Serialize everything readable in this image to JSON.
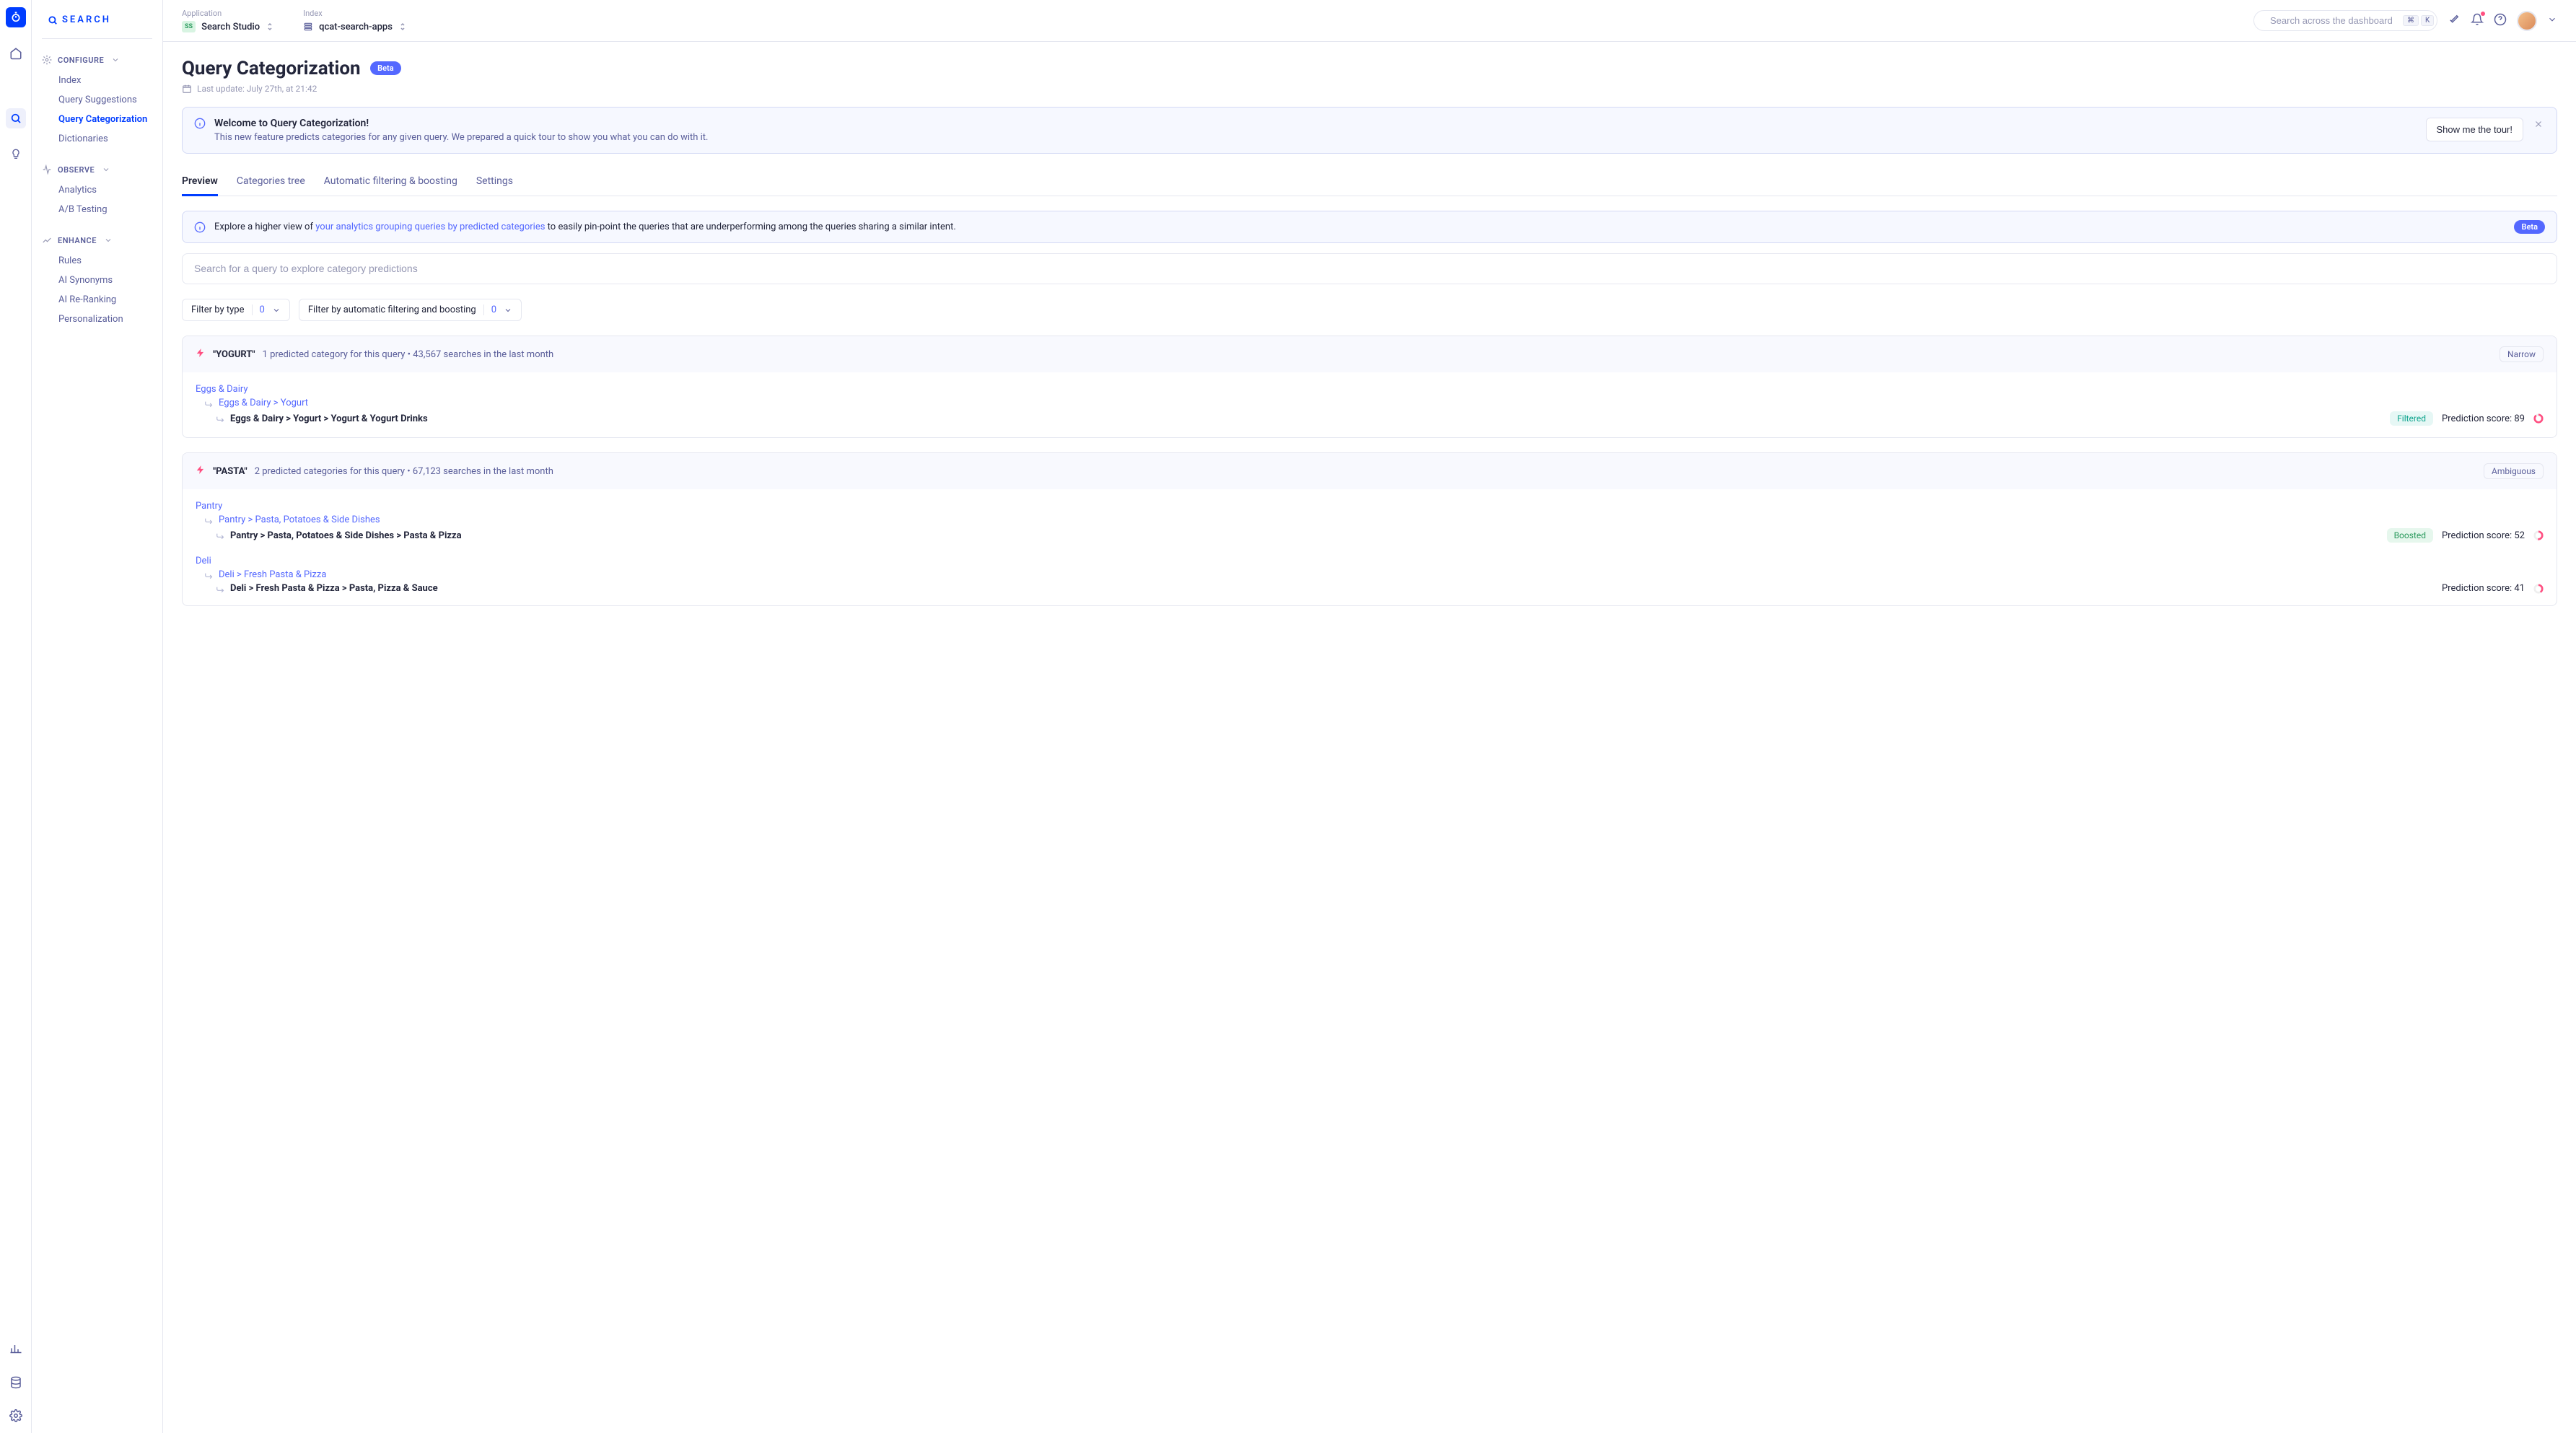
{
  "brand": "SEARCH",
  "topbar": {
    "application_label": "Application",
    "application_value": "Search Studio",
    "application_chip": "SS",
    "index_label": "Index",
    "index_value": "qcat-search-apps",
    "search_placeholder": "Search across the dashboard",
    "kbd1": "⌘",
    "kbd2": "K"
  },
  "sidebar": {
    "sections": [
      {
        "title": "CONFIGURE",
        "items": [
          "Index",
          "Query Suggestions",
          "Query Categorization",
          "Dictionaries"
        ],
        "active": 2
      },
      {
        "title": "OBSERVE",
        "items": [
          "Analytics",
          "A/B Testing"
        ]
      },
      {
        "title": "ENHANCE",
        "items": [
          "Rules",
          "AI Synonyms",
          "AI Re-Ranking",
          "Personalization"
        ]
      }
    ]
  },
  "page": {
    "title": "Query Categorization",
    "beta": "Beta",
    "last_update": "Last update: July 27th, at 21:42"
  },
  "welcome": {
    "title": "Welcome to Query Categorization!",
    "desc": "This new feature predicts categories for any given query. We prepared a quick tour to show you what you can do with it.",
    "button": "Show me the tour!"
  },
  "tabs": [
    "Preview",
    "Categories tree",
    "Automatic filtering & boosting",
    "Settings"
  ],
  "banner": {
    "pre": "Explore a higher view of ",
    "link": "your analytics grouping queries by predicted categories",
    "post": " to easily pin-point the queries that are underperforming among the queries sharing a similar intent.",
    "beta": "Beta"
  },
  "query_search_placeholder": "Search for a query to explore category predictions",
  "filters": {
    "type_label": "Filter by type",
    "type_count": "0",
    "auto_label": "Filter by automatic filtering and boosting",
    "auto_count": "0"
  },
  "results": [
    {
      "query": "\"YOGURT\"",
      "meta": "1 predicted category for this query • 43,567 searches in the last month",
      "tag": "Narrow",
      "blocks": [
        {
          "l0": "Eggs & Dairy",
          "l1": "Eggs & Dairy > Yogurt",
          "l2": "Eggs & Dairy > Yogurt > Yogurt & Yogurt Drinks",
          "pill": "Filtered",
          "pillType": "filtered",
          "score_label": "Prediction score: 89",
          "score_color": "#ff4f81",
          "score_pct": 89
        }
      ]
    },
    {
      "query": "\"PASTA\"",
      "meta": "2 predicted categories for this query • 67,123 searches in the last month",
      "tag": "Ambiguous",
      "blocks": [
        {
          "l0": "Pantry",
          "l1": "Pantry > Pasta, Potatoes & Side Dishes",
          "l2": "Pantry > Pasta, Potatoes & Side Dishes > Pasta & Pizza",
          "pill": "Boosted",
          "pillType": "boosted",
          "score_label": "Prediction score: 52",
          "score_color": "#ff4f81",
          "score_pct": 52
        },
        {
          "l0": "Deli",
          "l1": "Deli > Fresh Pasta & Pizza",
          "l2": "Deli > Fresh Pasta & Pizza > Pasta, Pizza & Sauce",
          "pill": "",
          "pillType": "",
          "score_label": "Prediction score: 41",
          "score_color": "#ff4f81",
          "score_pct": 41
        }
      ]
    }
  ]
}
